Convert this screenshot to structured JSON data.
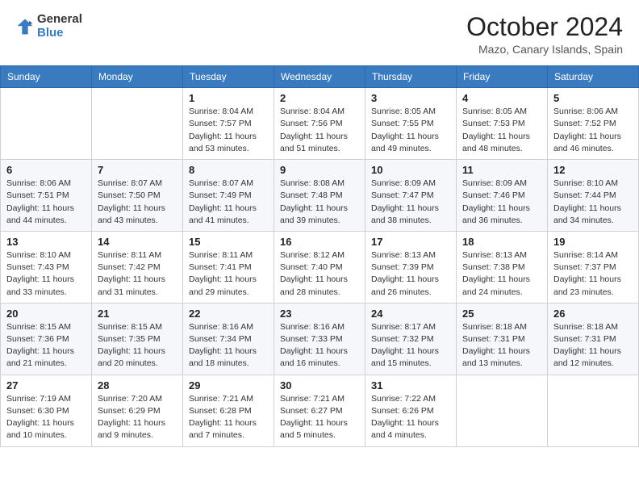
{
  "header": {
    "logo_general": "General",
    "logo_blue": "Blue",
    "month": "October 2024",
    "location": "Mazo, Canary Islands, Spain"
  },
  "weekdays": [
    "Sunday",
    "Monday",
    "Tuesday",
    "Wednesday",
    "Thursday",
    "Friday",
    "Saturday"
  ],
  "weeks": [
    [
      {
        "day": "",
        "info": ""
      },
      {
        "day": "",
        "info": ""
      },
      {
        "day": "1",
        "info": "Sunrise: 8:04 AM\nSunset: 7:57 PM\nDaylight: 11 hours and 53 minutes."
      },
      {
        "day": "2",
        "info": "Sunrise: 8:04 AM\nSunset: 7:56 PM\nDaylight: 11 hours and 51 minutes."
      },
      {
        "day": "3",
        "info": "Sunrise: 8:05 AM\nSunset: 7:55 PM\nDaylight: 11 hours and 49 minutes."
      },
      {
        "day": "4",
        "info": "Sunrise: 8:05 AM\nSunset: 7:53 PM\nDaylight: 11 hours and 48 minutes."
      },
      {
        "day": "5",
        "info": "Sunrise: 8:06 AM\nSunset: 7:52 PM\nDaylight: 11 hours and 46 minutes."
      }
    ],
    [
      {
        "day": "6",
        "info": "Sunrise: 8:06 AM\nSunset: 7:51 PM\nDaylight: 11 hours and 44 minutes."
      },
      {
        "day": "7",
        "info": "Sunrise: 8:07 AM\nSunset: 7:50 PM\nDaylight: 11 hours and 43 minutes."
      },
      {
        "day": "8",
        "info": "Sunrise: 8:07 AM\nSunset: 7:49 PM\nDaylight: 11 hours and 41 minutes."
      },
      {
        "day": "9",
        "info": "Sunrise: 8:08 AM\nSunset: 7:48 PM\nDaylight: 11 hours and 39 minutes."
      },
      {
        "day": "10",
        "info": "Sunrise: 8:09 AM\nSunset: 7:47 PM\nDaylight: 11 hours and 38 minutes."
      },
      {
        "day": "11",
        "info": "Sunrise: 8:09 AM\nSunset: 7:46 PM\nDaylight: 11 hours and 36 minutes."
      },
      {
        "day": "12",
        "info": "Sunrise: 8:10 AM\nSunset: 7:44 PM\nDaylight: 11 hours and 34 minutes."
      }
    ],
    [
      {
        "day": "13",
        "info": "Sunrise: 8:10 AM\nSunset: 7:43 PM\nDaylight: 11 hours and 33 minutes."
      },
      {
        "day": "14",
        "info": "Sunrise: 8:11 AM\nSunset: 7:42 PM\nDaylight: 11 hours and 31 minutes."
      },
      {
        "day": "15",
        "info": "Sunrise: 8:11 AM\nSunset: 7:41 PM\nDaylight: 11 hours and 29 minutes."
      },
      {
        "day": "16",
        "info": "Sunrise: 8:12 AM\nSunset: 7:40 PM\nDaylight: 11 hours and 28 minutes."
      },
      {
        "day": "17",
        "info": "Sunrise: 8:13 AM\nSunset: 7:39 PM\nDaylight: 11 hours and 26 minutes."
      },
      {
        "day": "18",
        "info": "Sunrise: 8:13 AM\nSunset: 7:38 PM\nDaylight: 11 hours and 24 minutes."
      },
      {
        "day": "19",
        "info": "Sunrise: 8:14 AM\nSunset: 7:37 PM\nDaylight: 11 hours and 23 minutes."
      }
    ],
    [
      {
        "day": "20",
        "info": "Sunrise: 8:15 AM\nSunset: 7:36 PM\nDaylight: 11 hours and 21 minutes."
      },
      {
        "day": "21",
        "info": "Sunrise: 8:15 AM\nSunset: 7:35 PM\nDaylight: 11 hours and 20 minutes."
      },
      {
        "day": "22",
        "info": "Sunrise: 8:16 AM\nSunset: 7:34 PM\nDaylight: 11 hours and 18 minutes."
      },
      {
        "day": "23",
        "info": "Sunrise: 8:16 AM\nSunset: 7:33 PM\nDaylight: 11 hours and 16 minutes."
      },
      {
        "day": "24",
        "info": "Sunrise: 8:17 AM\nSunset: 7:32 PM\nDaylight: 11 hours and 15 minutes."
      },
      {
        "day": "25",
        "info": "Sunrise: 8:18 AM\nSunset: 7:31 PM\nDaylight: 11 hours and 13 minutes."
      },
      {
        "day": "26",
        "info": "Sunrise: 8:18 AM\nSunset: 7:31 PM\nDaylight: 11 hours and 12 minutes."
      }
    ],
    [
      {
        "day": "27",
        "info": "Sunrise: 7:19 AM\nSunset: 6:30 PM\nDaylight: 11 hours and 10 minutes."
      },
      {
        "day": "28",
        "info": "Sunrise: 7:20 AM\nSunset: 6:29 PM\nDaylight: 11 hours and 9 minutes."
      },
      {
        "day": "29",
        "info": "Sunrise: 7:21 AM\nSunset: 6:28 PM\nDaylight: 11 hours and 7 minutes."
      },
      {
        "day": "30",
        "info": "Sunrise: 7:21 AM\nSunset: 6:27 PM\nDaylight: 11 hours and 5 minutes."
      },
      {
        "day": "31",
        "info": "Sunrise: 7:22 AM\nSunset: 6:26 PM\nDaylight: 11 hours and 4 minutes."
      },
      {
        "day": "",
        "info": ""
      },
      {
        "day": "",
        "info": ""
      }
    ]
  ]
}
